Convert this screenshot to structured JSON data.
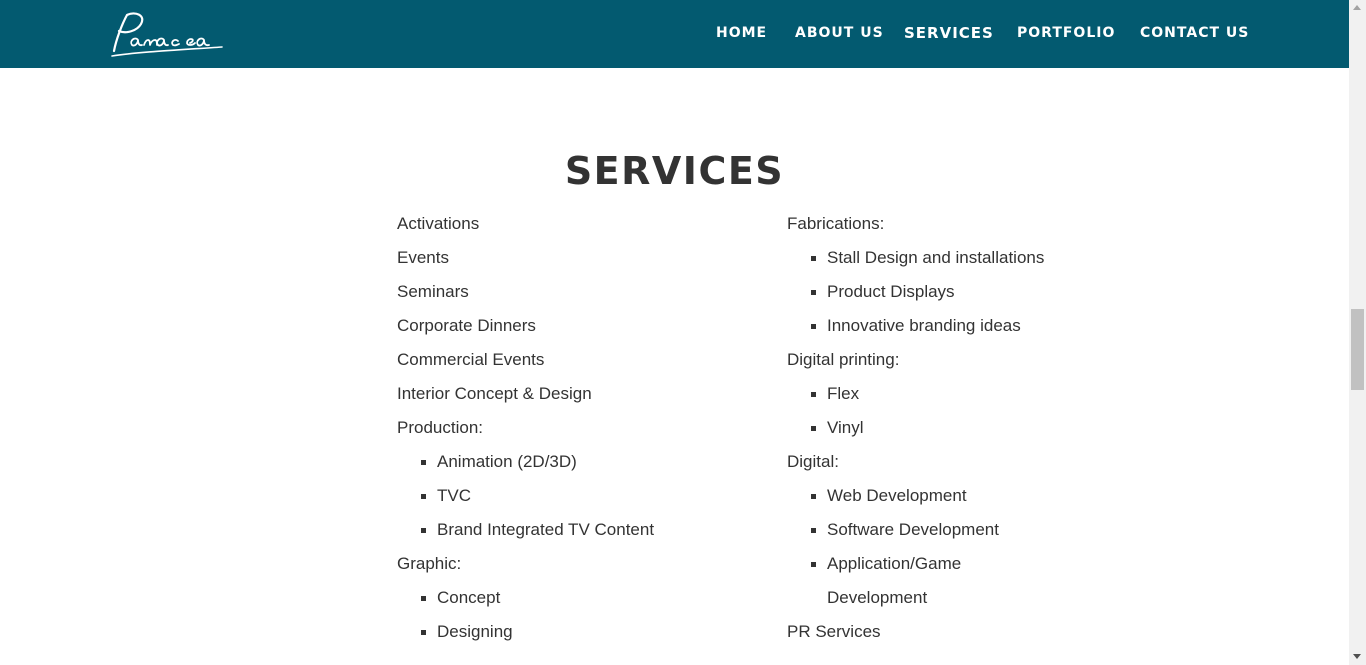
{
  "brand": {
    "logo_text": "Panacea"
  },
  "nav": {
    "items": [
      "HOME",
      "ABOUT US",
      "SERVICES",
      "PORTFOLIO",
      "CONTACT US"
    ],
    "active": "SERVICES"
  },
  "page": {
    "title": "SERVICES"
  },
  "services": {
    "left": {
      "items": [
        "Activations",
        "Events",
        "Seminars",
        "Corporate Dinners",
        "Commercial Events",
        "Interior Concept & Design"
      ],
      "production": {
        "label": "Production:",
        "items": [
          "Animation (2D/3D)",
          "TVC",
          "Brand Integrated TV Content"
        ]
      },
      "graphic": {
        "label": "Graphic:",
        "items": [
          "Concept",
          "Designing"
        ]
      }
    },
    "right": {
      "fabrications": {
        "label": "Fabrications:",
        "items": [
          "Stall Design and installations",
          "Product Displays",
          "Innovative branding ideas"
        ]
      },
      "digital_printing": {
        "label": "Digital printing:",
        "items": [
          "Flex",
          "Vinyl"
        ]
      },
      "digital": {
        "label": "Digital:",
        "items": [
          "Web Development",
          "Software Development",
          "Application/Game"
        ],
        "continuation": "Development"
      },
      "pr": "PR Services"
    }
  },
  "colors": {
    "navbar": "#035a70",
    "text": "#333333",
    "nav_text": "#ffffff"
  }
}
